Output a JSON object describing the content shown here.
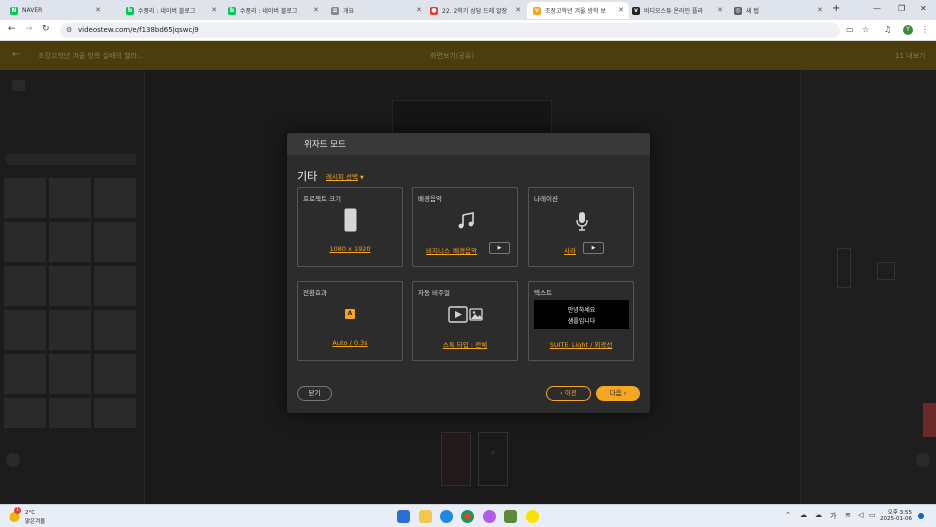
{
  "browser": {
    "tabs": [
      {
        "label": "NAVER",
        "icon": "naver-icon",
        "color": "#03c75a",
        "glyph": "N"
      },
      {
        "label": "수풍리 : 네이버 블로그",
        "icon": "blog-icon",
        "color": "#03c75a",
        "glyph": "b"
      },
      {
        "label": "수풍리 : 네이버 블로그",
        "icon": "blog-icon",
        "color": "#03c75a",
        "glyph": "b"
      },
      {
        "label": "개요",
        "icon": "document-icon",
        "color": "#888888",
        "glyph": "≡"
      },
      {
        "label": "22. 2학기 상담 드레 알장",
        "icon": "record-icon",
        "color": "#e53935",
        "glyph": "●"
      },
      {
        "label": "조장고학년 겨울 방학 보",
        "icon": "vrew-icon",
        "color": "#f5a623",
        "glyph": "v"
      },
      {
        "label": "비디오스튜 온라인 플라",
        "icon": "vrew-icon",
        "color": "#222222",
        "glyph": "v"
      },
      {
        "label": "새 탭",
        "icon": "globe-icon",
        "color": "#5f6368",
        "glyph": "◎"
      }
    ],
    "active_tab": 5,
    "url": "videostew.com/e/f138bd65jqswcj9"
  },
  "app_header": {
    "title": "조장고학년 겨울 방학 실배의 챌라...",
    "center": "화면보기(공유)",
    "right": "11 내보기"
  },
  "modal": {
    "title": "위자드 모드",
    "section_title": "기타",
    "preset_label": "레시피 선택",
    "cards": [
      {
        "label": "프로젝트 크기",
        "value": "1080 x 1920",
        "icon": "phone-frame-icon"
      },
      {
        "label": "배경음악",
        "value": "비지니스_배경음악",
        "icon": "music-note-icon",
        "play": "▶"
      },
      {
        "label": "나레이션",
        "value": "사라",
        "icon": "microphone-icon",
        "play": "▶"
      },
      {
        "label": "전환효과",
        "value": "Auto / 0.3s",
        "icon": "transition-icon",
        "glyph": "A"
      },
      {
        "label": "자동 비주얼",
        "value": "스톡 타입 : 전체",
        "icon": "media-icon"
      },
      {
        "label": "텍스트",
        "value": "SUITE_Light / 외곽선",
        "icon": "text-preview",
        "preview_line1": "안녕하세요",
        "preview_line2": "샘플입니다"
      }
    ],
    "close_label": "닫기",
    "prev_label": "이전",
    "next_label": "다음"
  },
  "taskbar": {
    "weather_temp": "2°C",
    "weather_desc": "맑은겨울",
    "weather_badge": "1",
    "ime": "가",
    "time": "오후 3:55",
    "date": "2025-01-06"
  },
  "colors": {
    "accent": "#f5a623",
    "modal_bg": "#2c2c2c",
    "card_border": "#555555"
  }
}
